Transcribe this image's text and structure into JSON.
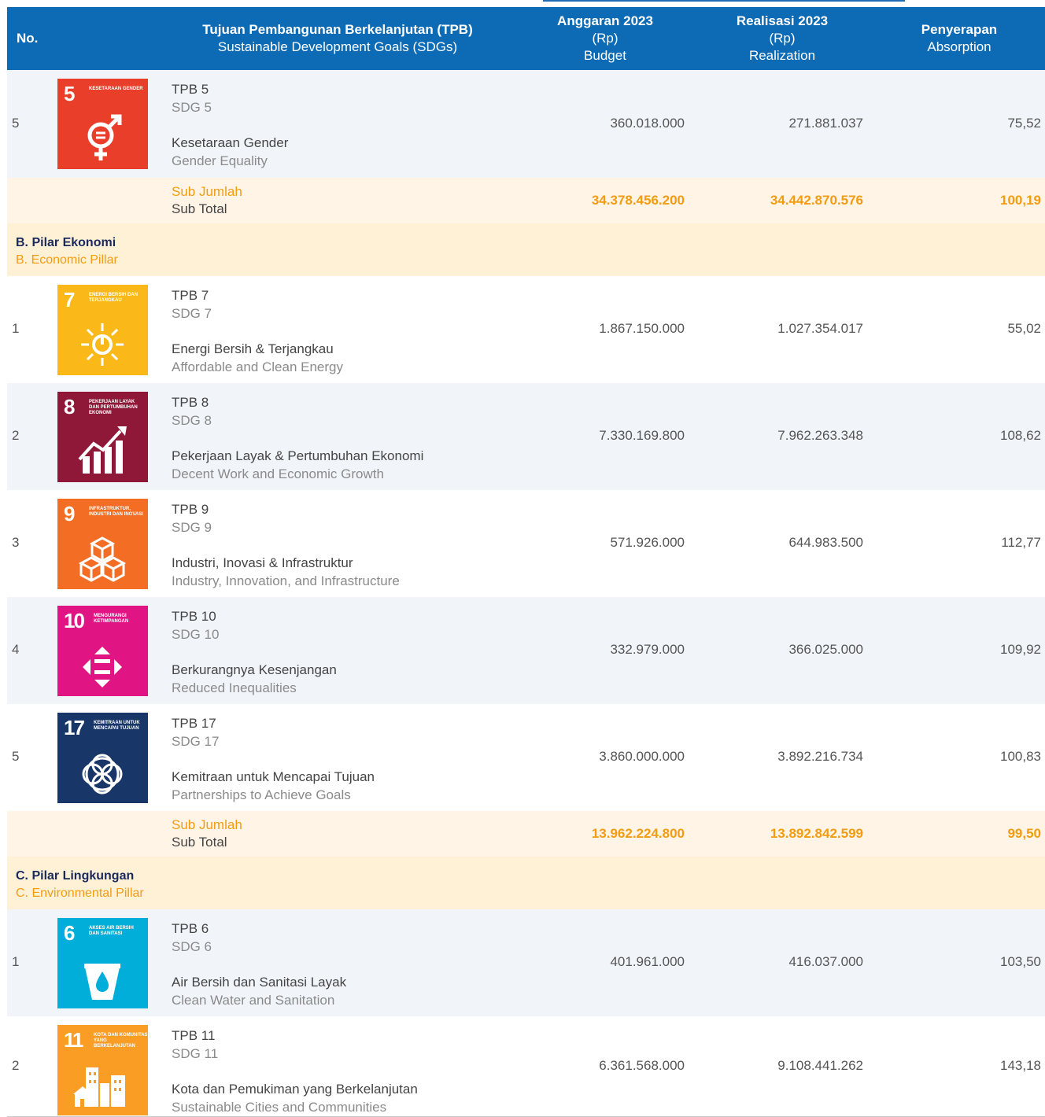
{
  "header": {
    "no": "No.",
    "tpb_title": "Tujuan Pembangunan Berkelanjutan (TPB)",
    "tpb_subtitle": "Sustainable Development Goals (SDGs)",
    "budget_title": "Anggaran 2023",
    "budget_unit": "(Rp)",
    "budget_en": "Budget",
    "real_title": "Realisasi 2023",
    "real_unit": "(Rp)",
    "real_en": "Realization",
    "abs_title": "Penyerapan",
    "abs_en": "Absorption"
  },
  "rows": [
    {
      "no": "5",
      "tpb": "TPB 5",
      "sdg": "SDG 5",
      "name_id": "Kesetaraan Gender",
      "name_en": "Gender Equality",
      "budget": "360.018.000",
      "real": "271.881.037",
      "abs": "75,52",
      "icon_num": "5",
      "icon_label": "KESETARAAN GENDER",
      "icon_color": "#e83e2a",
      "icon_name": "gender-equality-icon"
    },
    {
      "no": "1",
      "tpb": "TPB 7",
      "sdg": "SDG 7",
      "name_id": "Energi Bersih & Terjangkau",
      "name_en": "Affordable and Clean Energy",
      "budget": "1.867.150.000",
      "real": "1.027.354.017",
      "abs": "55,02",
      "icon_num": "7",
      "icon_label": "ENERGI BERSIH DAN TERJANGKAU",
      "icon_color": "#fbb919",
      "icon_name": "clean-energy-icon"
    },
    {
      "no": "2",
      "tpb": "TPB 8",
      "sdg": "SDG 8",
      "name_id": "Pekerjaan Layak & Pertumbuhan Ekonomi",
      "name_en": "Decent Work and Economic Growth",
      "budget": "7.330.169.800",
      "real": "7.962.263.348",
      "abs": "108,62",
      "icon_num": "8",
      "icon_label": "PEKERJAAN LAYAK DAN PERTUMBUHAN EKONOMI",
      "icon_color": "#8f1838",
      "icon_name": "economic-growth-icon"
    },
    {
      "no": "3",
      "tpb": "TPB 9",
      "sdg": "SDG 9",
      "name_id": "Industri, Inovasi & Infrastruktur",
      "name_en": "Industry, Innovation, and Infrastructure",
      "budget": "571.926.000",
      "real": "644.983.500",
      "abs": "112,77",
      "icon_num": "9",
      "icon_label": "INFRASTRUKTUR, INDUSTRI DAN INOVASI",
      "icon_color": "#f36e24",
      "icon_name": "infrastructure-icon"
    },
    {
      "no": "4",
      "tpb": "TPB 10",
      "sdg": "SDG 10",
      "name_id": "Berkurangnya Kesenjangan",
      "name_en": "Reduced Inequalities",
      "budget": "332.979.000",
      "real": "366.025.000",
      "abs": "109,92",
      "icon_num": "10",
      "icon_label": "MENGURANGI KETIMPANGAN",
      "icon_color": "#e01483",
      "icon_name": "reduced-inequalities-icon"
    },
    {
      "no": "5",
      "tpb": "TPB 17",
      "sdg": "SDG 17",
      "name_id": "Kemitraan untuk Mencapai Tujuan",
      "name_en": "Partnerships to Achieve Goals",
      "budget": "3.860.000.000",
      "real": "3.892.216.734",
      "abs": "100,83",
      "icon_num": "17",
      "icon_label": "KEMITRAAN UNTUK MENCAPAI TUJUAN",
      "icon_color": "#183668",
      "icon_name": "partnership-icon"
    },
    {
      "no": "1",
      "tpb": "TPB 6",
      "sdg": "SDG 6",
      "name_id": "Air Bersih dan Sanitasi Layak",
      "name_en": "Clean Water and Sanitation",
      "budget": "401.961.000",
      "real": "416.037.000",
      "abs": "103,50",
      "icon_num": "6",
      "icon_label": "AKSES AIR BERSIH DAN SANITASI",
      "icon_color": "#00aed9",
      "icon_name": "clean-water-icon"
    },
    {
      "no": "2",
      "tpb": "TPB 11",
      "sdg": "SDG 11",
      "name_id": "Kota dan Pemukiman yang Berkelanjutan",
      "name_en": "Sustainable Cities and Communities",
      "budget": "6.361.568.000",
      "real": "9.108.441.262",
      "abs": "143,18",
      "icon_num": "11",
      "icon_label": "KOTA DAN KOMUNITAS YANG BERKELANJUTAN",
      "icon_color": "#f99d25",
      "icon_name": "sustainable-cities-icon"
    }
  ],
  "subtotals": [
    {
      "label_id": "Sub Jumlah",
      "label_en": "Sub Total",
      "budget": "34.378.456.200",
      "real": "34.442.870.576",
      "abs": "100,19"
    },
    {
      "label_id": "Sub Jumlah",
      "label_en": "Sub Total",
      "budget": "13.962.224.800",
      "real": "13.892.842.599",
      "abs": "99,50"
    }
  ],
  "pillars": [
    {
      "title_id": "B. Pilar Ekonomi",
      "title_en": "B. Economic Pillar"
    },
    {
      "title_id": "C. Pilar Lingkungan",
      "title_en": "C. Environmental Pillar"
    }
  ],
  "colors": {
    "header_bg": "#0d6bb5",
    "subtotal_text": "#f39c12",
    "pillar_title": "#1b2a5c"
  }
}
